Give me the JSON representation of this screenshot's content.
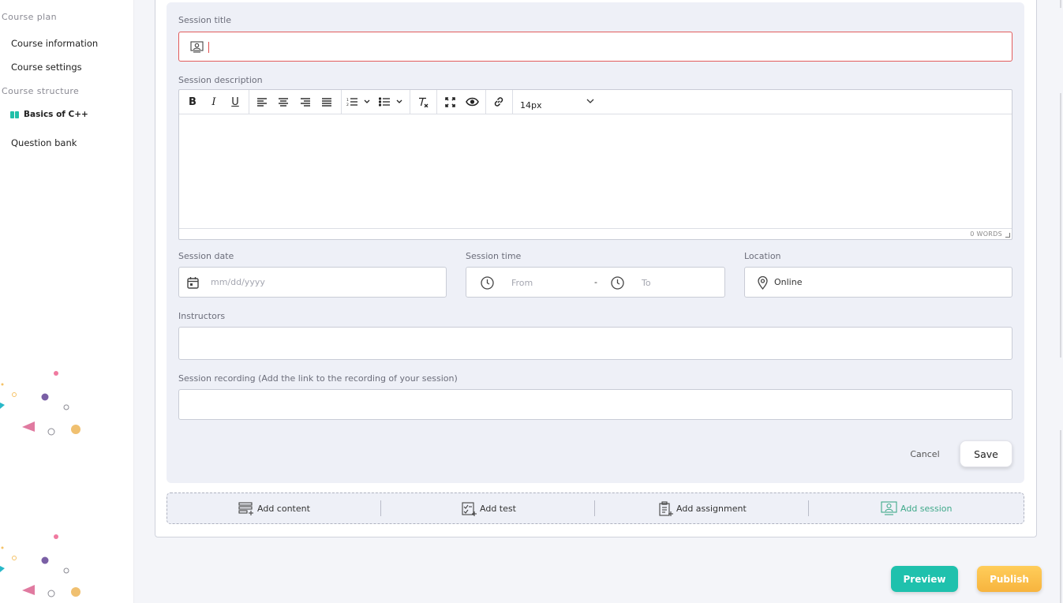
{
  "sidebar": {
    "course_plan_heading": "Course plan",
    "course_information": "Course information",
    "course_settings": "Course settings",
    "course_structure_heading": "Course structure",
    "active_item": "Basics of C++",
    "question_bank": "Question bank"
  },
  "form": {
    "session_title_label": "Session title",
    "session_title_value": "",
    "session_description_label": "Session description",
    "editor": {
      "bold": "B",
      "italic": "I",
      "underline": "U",
      "font_size": "14px",
      "word_count": "0 WORDS"
    },
    "session_date_label": "Session date",
    "session_date_placeholder": "mm/dd/yyyy",
    "session_time_label": "Session time",
    "time_from_placeholder": "From",
    "time_separator": "-",
    "time_to_placeholder": "To",
    "location_label": "Location",
    "location_value": "Online",
    "instructors_label": "Instructors",
    "recording_label": "Session recording (Add the link to the recording of your session)",
    "cancel_label": "Cancel",
    "save_label": "Save"
  },
  "add_bar": {
    "add_content": "Add content",
    "add_test": "Add test",
    "add_assignment": "Add assignment",
    "add_session": "Add session"
  },
  "footer": {
    "preview": "Preview",
    "publish": "Publish"
  },
  "colors": {
    "accent_teal": "#1fc1ad",
    "publish_orange": "#f7b43e",
    "error_red": "#e25c5c",
    "active_green": "#3fa98a"
  }
}
